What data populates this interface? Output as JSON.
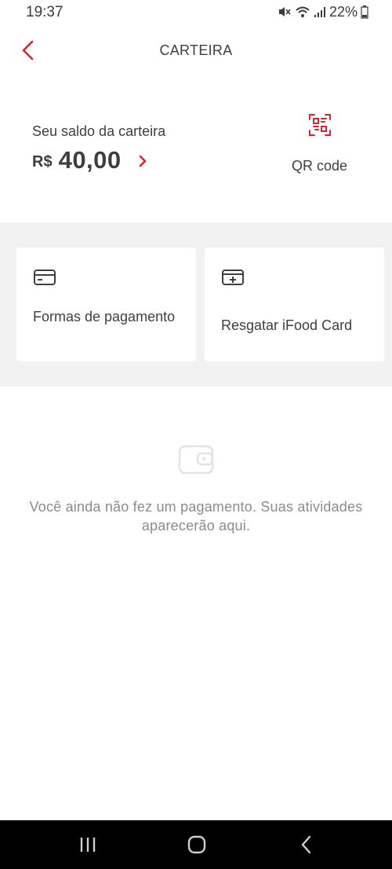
{
  "status_bar": {
    "time": "19:37",
    "battery_percent": "22%",
    "icons": [
      "mute-icon",
      "wifi-icon",
      "signal-icon",
      "battery-icon"
    ]
  },
  "header": {
    "title": "CARTEIRA",
    "back_icon": "chevron-left-icon"
  },
  "balance": {
    "label": "Seu saldo da carteira",
    "currency": "R$",
    "amount": "40,00",
    "chevron_icon": "chevron-right-icon"
  },
  "qr": {
    "label": "QR code",
    "icon": "qr-code-icon"
  },
  "cards": [
    {
      "label": "Formas de pagamento",
      "icon": "credit-card-icon"
    },
    {
      "label": "Resgatar iFood Card",
      "icon": "add-card-icon"
    }
  ],
  "empty_state": {
    "icon": "wallet-icon",
    "text": "Você ainda não fez um pagamento. Suas atividades aparecerão aqui."
  },
  "nav_bar": {
    "buttons": [
      "recents-icon",
      "home-icon",
      "back-icon"
    ]
  },
  "colors": {
    "accent": "#d6252f",
    "text": "#3e3e3e",
    "muted_text": "#8b8b8b",
    "section_bg": "#f2f2f2",
    "nav_bg": "#000000"
  }
}
